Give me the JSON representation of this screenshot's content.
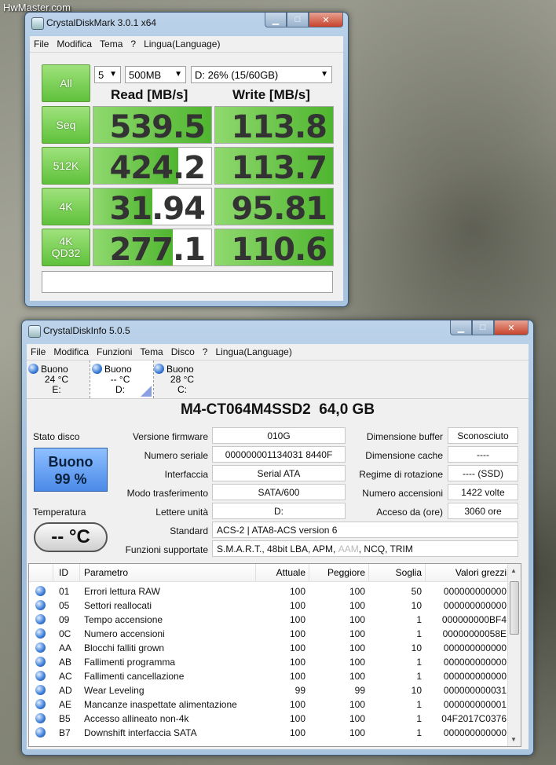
{
  "watermark": "HwMaster.com",
  "cdm": {
    "title": "CrystalDiskMark 3.0.1 x64",
    "menu": [
      "File",
      "Modifica",
      "Tema",
      "?",
      "Lingua(Language)"
    ],
    "all_label": "All",
    "count": "5",
    "size": "500MB",
    "drive": "D: 26% (15/60GB)",
    "read_header": "Read [MB/s]",
    "write_header": "Write [MB/s]",
    "tests": [
      {
        "label": "Seq",
        "read": "539.5",
        "write": "113.8",
        "read_fill": 1.0,
        "write_fill": 1.0
      },
      {
        "label": "512K",
        "read": "424.2",
        "write": "113.7",
        "read_fill": 0.72,
        "write_fill": 1.0
      },
      {
        "label": "4K",
        "read": "31.94",
        "write": "95.81",
        "read_fill": 0.5,
        "write_fill": 1.0
      },
      {
        "label": "4K\nQD32",
        "read": "277.1",
        "write": "110.6",
        "read_fill": 0.67,
        "write_fill": 1.0
      }
    ]
  },
  "cdi": {
    "title": "CrystalDiskInfo 5.0.5",
    "menu": [
      "File",
      "Modifica",
      "Funzioni",
      "Tema",
      "Disco",
      "?",
      "Lingua(Language)"
    ],
    "disks": [
      {
        "status": "Buono",
        "temp": "24 °C",
        "letter": "E:"
      },
      {
        "status": "Buono",
        "temp": "-- °C",
        "letter": "D:"
      },
      {
        "status": "Buono",
        "temp": "28 °C",
        "letter": "C:"
      }
    ],
    "model": "M4-CT064M4SSD2  64,0 GB",
    "health_label": "Stato disco",
    "health_status": "Buono",
    "health_percent": "99 %",
    "temp_label": "Temperatura",
    "temp_value": "-- °C",
    "labels": {
      "firmware": "Versione firmware",
      "serial": "Numero seriale",
      "interface": "Interfaccia",
      "transfer": "Modo trasferimento",
      "letters": "Lettere unità",
      "standard": "Standard",
      "features": "Funzioni supportate",
      "buffer": "Dimensione buffer",
      "cache": "Dimensione cache",
      "rotation": "Regime di rotazione",
      "power_count": "Numero accensioni",
      "power_hours": "Acceso da (ore)"
    },
    "values": {
      "firmware": "010G",
      "serial": "000000001134031 8440F",
      "interface": "Serial ATA",
      "transfer": "SATA/600",
      "letters": "D:",
      "standard": "ACS-2 | ATA8-ACS version 6",
      "features_a": "S.M.A.R.T., 48bit LBA, APM, ",
      "features_b": "AAM",
      "features_c": ", NCQ, TRIM",
      "buffer": "Sconosciuto",
      "cache": "----",
      "rotation": "---- (SSD)",
      "power_count": "1422 volte",
      "power_hours": "3060 ore"
    },
    "smart_headers": [
      "ID",
      "Parametro",
      "Attuale",
      "Peggiore",
      "Soglia",
      "Valori grezzi"
    ],
    "smart": [
      [
        "01",
        "Errori lettura RAW",
        "100",
        "100",
        "50",
        "000000000000"
      ],
      [
        "05",
        "Settori reallocati",
        "100",
        "100",
        "10",
        "000000000000"
      ],
      [
        "09",
        "Tempo accensione",
        "100",
        "100",
        "1",
        "000000000BF4"
      ],
      [
        "0C",
        "Numero accensioni",
        "100",
        "100",
        "1",
        "00000000058E"
      ],
      [
        "AA",
        "Blocchi falliti grown",
        "100",
        "100",
        "10",
        "000000000000"
      ],
      [
        "AB",
        "Fallimenti programma",
        "100",
        "100",
        "1",
        "000000000000"
      ],
      [
        "AC",
        "Fallimenti cancellazione",
        "100",
        "100",
        "1",
        "000000000000"
      ],
      [
        "AD",
        "Wear Leveling",
        "99",
        "99",
        "10",
        "000000000031"
      ],
      [
        "AE",
        "Mancanze inaspettate alimentazione",
        "100",
        "100",
        "1",
        "000000000001"
      ],
      [
        "B5",
        "Accesso allineato non-4k",
        "100",
        "100",
        "1",
        "04F2017C0376"
      ],
      [
        "B7",
        "Downshift interfaccia SATA",
        "100",
        "100",
        "1",
        "000000000000"
      ]
    ]
  }
}
